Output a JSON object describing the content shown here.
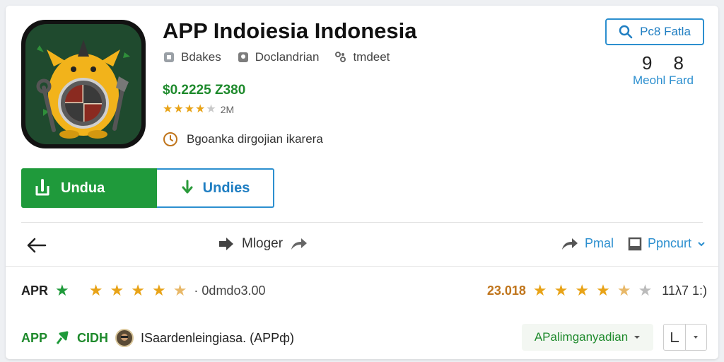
{
  "app": {
    "title": "APP Indoiesia Indonesia",
    "meta": [
      {
        "label": "Bdakes",
        "icon": "category-icon"
      },
      {
        "label": "Doclandrian",
        "icon": "developer-icon"
      },
      {
        "label": "tmdeet",
        "icon": "share-icon"
      }
    ],
    "price": "$0.2225  Z380",
    "rating_stars": 4,
    "rating_count": "2M",
    "note": "Bgoanka dirgojian ikarera"
  },
  "buttons": {
    "primary_label": "Undua",
    "secondary_label": "Undies",
    "search_label": "Pc8 Fatla"
  },
  "stats": {
    "values": [
      "9",
      "8"
    ],
    "label": "Meohl Fard"
  },
  "nav": {
    "center_label": "Mloger",
    "right_label_1": "Pmal",
    "right_label_2": "Ppncurt"
  },
  "review_row": {
    "tag": "APR",
    "stars": 4.5,
    "text": "· 0dmdo3.00",
    "right_number": "23.018",
    "right_stars": 4.5,
    "right_text": "11λ7 1:)"
  },
  "bottom_row": {
    "tag": "APP",
    "code": "CIDH",
    "text": "ISaardenleingiasa. (APPф)",
    "select_label": "APalimganyadian",
    "split_left_icon": "layout-icon",
    "split_right_icon": "chevron-down-icon"
  },
  "colors": {
    "green": "#1f9a3b",
    "blue": "#2c8fcf",
    "star": "#e8a317",
    "orange": "#c0751c"
  }
}
